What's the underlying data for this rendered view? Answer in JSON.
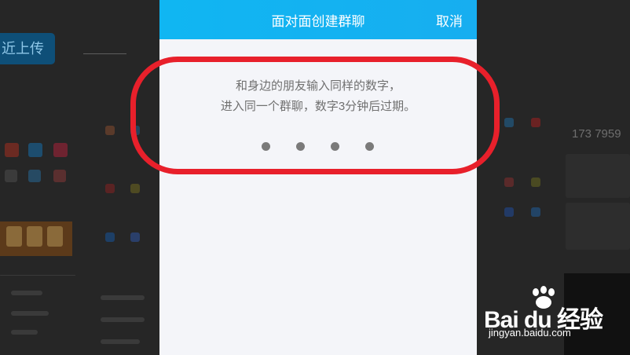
{
  "dialog": {
    "title": "面对面创建群聊",
    "cancel_label": "取消",
    "message_line1": "和身边的朋友输入同样的数字，",
    "message_line2": "进入同一个群聊，数字3分钟后过期。",
    "pin_dots": 4
  },
  "background": {
    "upload_label": "近上传",
    "phone_number": "173 7959"
  },
  "watermark": {
    "brand": "Bai du 经验",
    "url": "jingyan.baidu.com"
  },
  "colors": {
    "header": "#12b4f1",
    "highlight_ring": "#e8202b",
    "dialog_bg": "#f4f5f9",
    "dot": "#7a7a7a"
  }
}
